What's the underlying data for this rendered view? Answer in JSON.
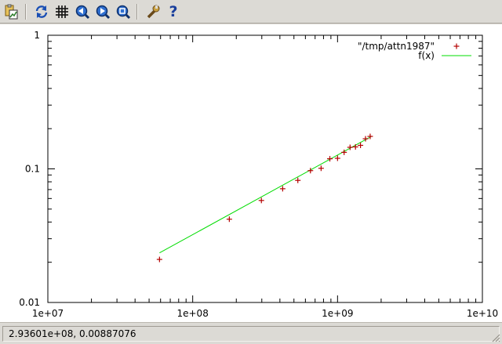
{
  "toolbar": {
    "icons": [
      "copy-clipboard-icon",
      "replot-icon",
      "grid-icon",
      "zoom-previous-icon",
      "zoom-next-icon",
      "unzoom-icon",
      "options-icon",
      "help-icon"
    ],
    "help_glyph": "?"
  },
  "status": {
    "coordinates": "2.93601e+08,  0.00887076"
  },
  "colors": {
    "data_points": "#b40000",
    "fit_line": "#00dc00",
    "axis": "#000000",
    "background": "#ffffff"
  },
  "chart_data": {
    "type": "scatter",
    "title": "",
    "xlabel": "",
    "ylabel": "",
    "x_scale": "log",
    "y_scale": "log",
    "xlim": [
      10000000,
      10000000000
    ],
    "ylim": [
      0.01,
      1
    ],
    "grid": false,
    "legend_position": "top-right",
    "x_ticks": [
      {
        "value": 10000000,
        "label": "1e+07"
      },
      {
        "value": 100000000,
        "label": "1e+08"
      },
      {
        "value": 1000000000,
        "label": "1e+09"
      },
      {
        "value": 10000000000,
        "label": "1e+10"
      }
    ],
    "y_ticks": [
      {
        "value": 1,
        "label": "1"
      },
      {
        "value": 0.1,
        "label": "0.1"
      },
      {
        "value": 0.01,
        "label": "0.01"
      }
    ],
    "series": [
      {
        "name": "\"/tmp/attn1987\"",
        "kind": "points",
        "marker": "+",
        "x": [
          59000000,
          179000000,
          298000000,
          418000000,
          532000000,
          650000000,
          770000000,
          885000000,
          1000000000,
          1110000000,
          1220000000,
          1330000000,
          1440000000,
          1560000000,
          1680000000
        ],
        "y": [
          0.021,
          0.042,
          0.058,
          0.071,
          0.082,
          0.097,
          0.101,
          0.119,
          0.12,
          0.133,
          0.145,
          0.146,
          0.15,
          0.168,
          0.175
        ]
      },
      {
        "name": "f(x)",
        "kind": "line",
        "x": [
          59000000,
          1700000000
        ],
        "y": [
          0.0235,
          0.174
        ]
      }
    ]
  }
}
